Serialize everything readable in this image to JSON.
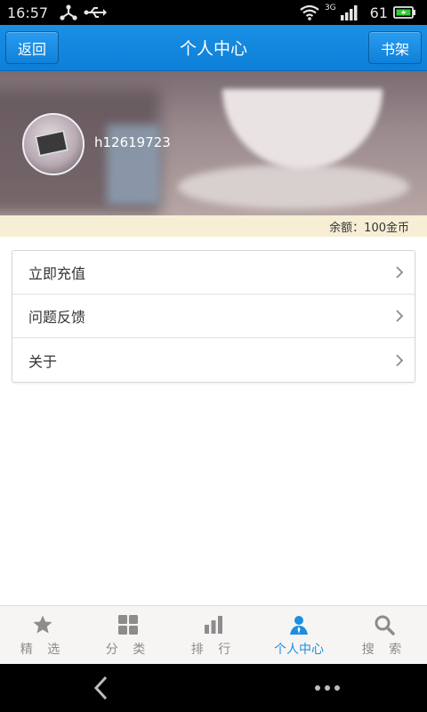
{
  "statusbar": {
    "time": "16:57",
    "signal_label": "3G",
    "battery_percent": "61",
    "icons": [
      "share-icon",
      "usb-icon",
      "wifi-icon",
      "signal-icon",
      "battery-icon"
    ]
  },
  "header": {
    "back_label": "返回",
    "title": "个人中心",
    "bookshelf_label": "书架"
  },
  "profile": {
    "username": "h12619723",
    "balance_text": "余额：100金币"
  },
  "menu": {
    "items": [
      {
        "label": "立即充值"
      },
      {
        "label": "问题反馈"
      },
      {
        "label": "关于"
      }
    ]
  },
  "bottom_nav": {
    "items": [
      {
        "label": "精 选",
        "icon": "star-icon",
        "active": false
      },
      {
        "label": "分 类",
        "icon": "grid-icon",
        "active": false
      },
      {
        "label": "排 行",
        "icon": "bar-chart-icon",
        "active": false
      },
      {
        "label": "个人中心",
        "icon": "person-icon",
        "active": true
      },
      {
        "label": "搜 索",
        "icon": "search-icon",
        "active": false
      }
    ]
  },
  "colors": {
    "accent": "#1c8fe0",
    "header": "#0d7fd8",
    "balance_bg": "#f6efd6"
  }
}
